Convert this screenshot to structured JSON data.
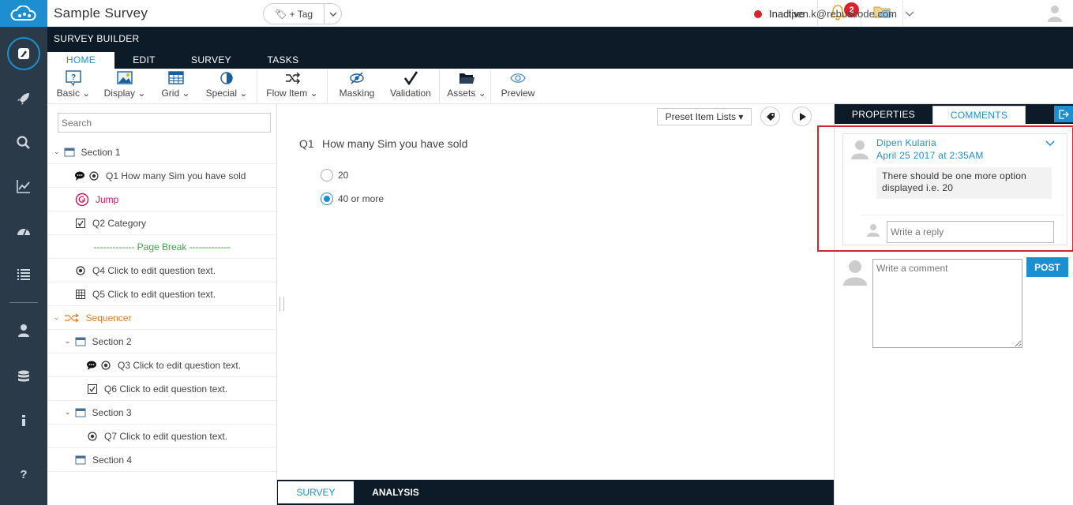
{
  "app": {
    "title": "Sample Survey",
    "tag_label": "+ Tag",
    "status": "Inactive",
    "notification_count": "2",
    "user_email": "dipen.k@rebuscode.com"
  },
  "ribbon": {
    "label": "SURVEY BUILDER",
    "tabs": [
      "HOME",
      "EDIT",
      "SURVEY",
      "TASKS"
    ],
    "tools": [
      "Basic",
      "Display",
      "Grid",
      "Special",
      "Flow Item",
      "Masking",
      "Validation",
      "Assets",
      "Preview"
    ]
  },
  "tree": {
    "search_placeholder": "Search",
    "items": [
      "Section 1",
      "Q1 How many Sim you have sold",
      "Jump",
      "Q2 Category",
      "------------- Page Break -------------",
      "Q4 Click to edit question text.",
      "Q5 Click to edit question text.",
      "Sequencer",
      "Section 2",
      "Q3 Click to edit question text.",
      "Q6 Click to edit question text.",
      "Section 3",
      "Q7 Click to edit question text.",
      "Section 4"
    ]
  },
  "canvas": {
    "preset_label": "Preset Item Lists ▾",
    "question_number": "Q1",
    "question_text": "How many Sim you have sold",
    "options": [
      "20",
      "40 or more"
    ],
    "selected_option": "40 or more"
  },
  "bottom_tabs": [
    "SURVEY",
    "ANALYSIS"
  ],
  "panel": {
    "tabs": [
      "PROPERTIES",
      "COMMENTS"
    ],
    "comment": {
      "author": "Dipen Kularia",
      "date": "April 25 2017 at 2:35AM",
      "body": "There should be one more option displayed i.e. 20"
    },
    "reply_placeholder": "Write a reply",
    "comment_placeholder": "Write a comment",
    "post_label": "POST"
  },
  "colors": {
    "accent": "#1d8fd1",
    "dark": "#0d1a27",
    "nav": "#2b3a48",
    "danger": "#d9232d",
    "jump": "#c2185b",
    "page_break": "#3aa84a",
    "sequencer": "#e07b24"
  }
}
